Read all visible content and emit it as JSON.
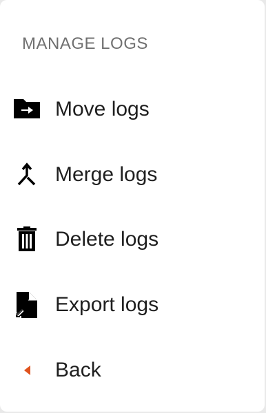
{
  "menu": {
    "title": "MANAGE LOGS",
    "items": [
      {
        "label": "Move logs",
        "icon": "folder-arrow-icon"
      },
      {
        "label": "Merge logs",
        "icon": "merge-icon"
      },
      {
        "label": "Delete logs",
        "icon": "trash-icon"
      },
      {
        "label": "Export logs",
        "icon": "file-export-icon"
      },
      {
        "label": "Back",
        "icon": "back-caret-icon"
      }
    ]
  },
  "colors": {
    "background": "#ffffff",
    "title": "#707070",
    "text": "#1f1f1f",
    "icon": "#000000",
    "back_accent": "#e0531e"
  }
}
